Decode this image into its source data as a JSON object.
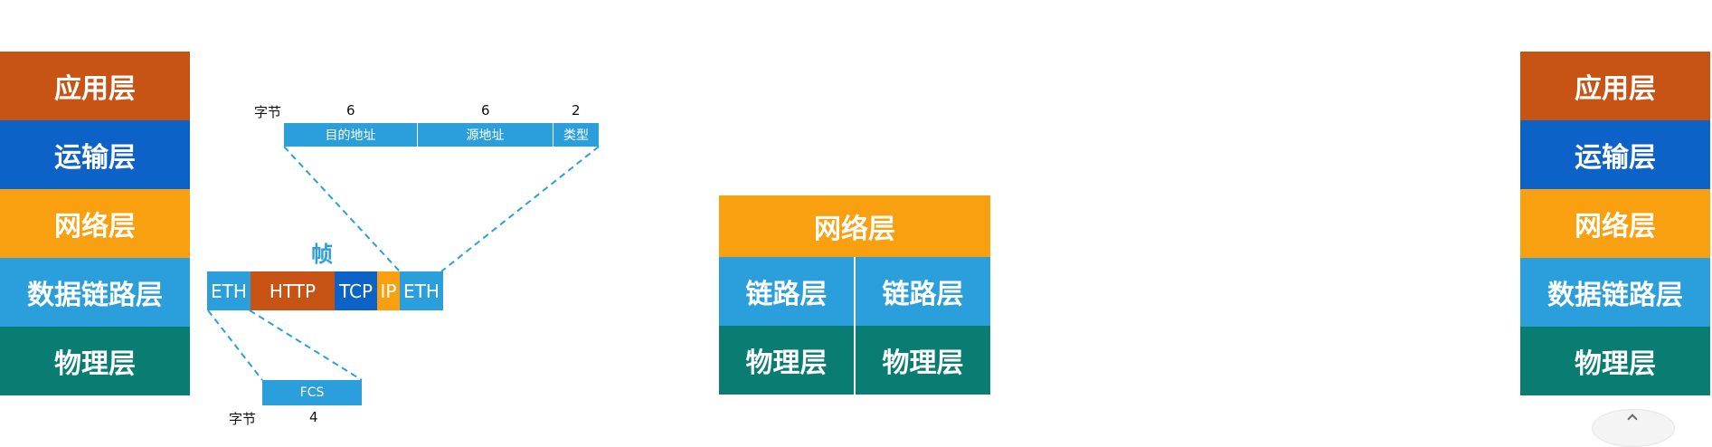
{
  "left_stack": {
    "layers": [
      "应用层",
      "运输层",
      "网络层",
      "数据链路层",
      "物理层"
    ]
  },
  "right_stack": {
    "layers": [
      "应用层",
      "运输层",
      "网络层",
      "数据链路层",
      "物理层"
    ]
  },
  "frame_diagram": {
    "header_unit_label": "字节",
    "header_sizes": [
      "6",
      "6",
      "2"
    ],
    "header_fields": [
      "目的地址",
      "源地址",
      "类型"
    ],
    "frame_title": "帧",
    "frame_segments": [
      "ETH",
      "HTTP",
      "TCP",
      "IP",
      "ETH"
    ],
    "trailer_field": "FCS",
    "trailer_unit_label": "字节",
    "trailer_size": "4"
  },
  "router": {
    "top_label": "网络层",
    "link_labels": [
      "链路层",
      "链路层"
    ],
    "physical_labels": [
      "物理层",
      "物理层"
    ]
  },
  "colors": {
    "application": "#c75414",
    "transport": "#0c62c7",
    "network": "#f8a010",
    "link": "#2b9fdb",
    "physical": "#0a7d72",
    "dashed_connector": "#2b9fdb"
  }
}
